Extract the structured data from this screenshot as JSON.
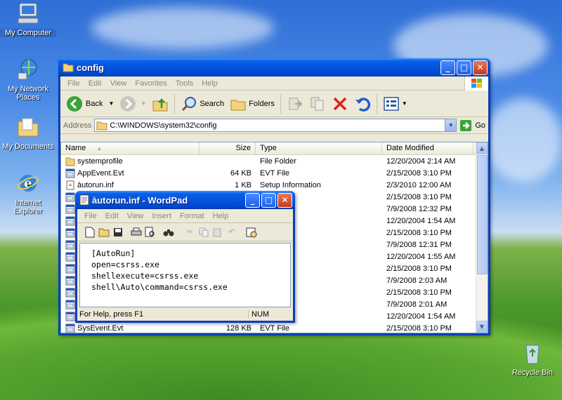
{
  "desktop": {
    "icons": [
      {
        "label": "My Computer"
      },
      {
        "label": "My Network Places"
      },
      {
        "label": "My Documents"
      },
      {
        "label": "Internet Explorer"
      },
      {
        "label": "Recycle Bin"
      }
    ]
  },
  "explorer": {
    "title": "config",
    "menu": [
      "File",
      "Edit",
      "View",
      "Favorites",
      "Tools",
      "Help"
    ],
    "toolbar": {
      "back": "Back",
      "search": "Search",
      "folders": "Folders"
    },
    "address": {
      "label": "Address",
      "value": "C:\\WINDOWS\\system32\\config",
      "go": "Go"
    },
    "columns": {
      "name": "Name",
      "size": "Size",
      "type": "Type",
      "date": "Date Modified"
    },
    "rows": [
      {
        "name": "systemprofile",
        "size": "",
        "type": "File Folder",
        "date": "12/20/2004 2:14 AM",
        "icon": "folder"
      },
      {
        "name": "AppEvent.Evt",
        "size": "64 KB",
        "type": "EVT File",
        "date": "2/15/2008 3:10 PM",
        "icon": "file"
      },
      {
        "name": "àutorun.inf",
        "size": "1 KB",
        "type": "Setup Information",
        "date": "2/3/2010 12:00 AM",
        "icon": "inf"
      },
      {
        "name": "",
        "size": "",
        "type": "",
        "date": "2/15/2008 3:10 PM",
        "icon": "file"
      },
      {
        "name": "",
        "size": "",
        "type": "ment",
        "date": "7/9/2008 12:32 PM",
        "icon": "file"
      },
      {
        "name": "",
        "size": "",
        "type": "",
        "date": "12/20/2004 1:54 AM",
        "icon": "file"
      },
      {
        "name": "",
        "size": "",
        "type": "",
        "date": "2/15/2008 3:10 PM",
        "icon": "file"
      },
      {
        "name": "",
        "size": "",
        "type": "ment",
        "date": "7/9/2008 12:31 PM",
        "icon": "file"
      },
      {
        "name": "",
        "size": "",
        "type": "",
        "date": "12/20/2004 1:55 AM",
        "icon": "file"
      },
      {
        "name": "",
        "size": "",
        "type": "",
        "date": "2/15/2008 3:10 PM",
        "icon": "file"
      },
      {
        "name": "",
        "size": "",
        "type": "ment",
        "date": "7/9/2008 2:03 AM",
        "icon": "file"
      },
      {
        "name": "",
        "size": "",
        "type": "",
        "date": "2/15/2008 3:10 PM",
        "icon": "file"
      },
      {
        "name": "",
        "size": "",
        "type": "ment",
        "date": "7/9/2008 2:01 AM",
        "icon": "file"
      },
      {
        "name": "",
        "size": "",
        "type": "",
        "date": "12/20/2004 1:54 AM",
        "icon": "file"
      },
      {
        "name": "SysEvent.Evt",
        "size": "128 KB",
        "type": "EVT File",
        "date": "2/15/2008 3:10 PM",
        "icon": "file"
      }
    ]
  },
  "wordpad": {
    "title": "àutorun.inf - WordPad",
    "menu": [
      "File",
      "Edit",
      "View",
      "Insert",
      "Format",
      "Help"
    ],
    "lines": [
      "[AutoRun]",
      "open=csrss.exe",
      "shellexecute=csrss.exe",
      "shell\\Auto\\command=csrss.exe"
    ],
    "status": {
      "help": "For Help, press F1",
      "num": "NUM"
    }
  },
  "colors": {
    "title_bar": "#0554dc",
    "desktop_sky": "#4a8ae6",
    "grass": "#4f9a2c"
  }
}
